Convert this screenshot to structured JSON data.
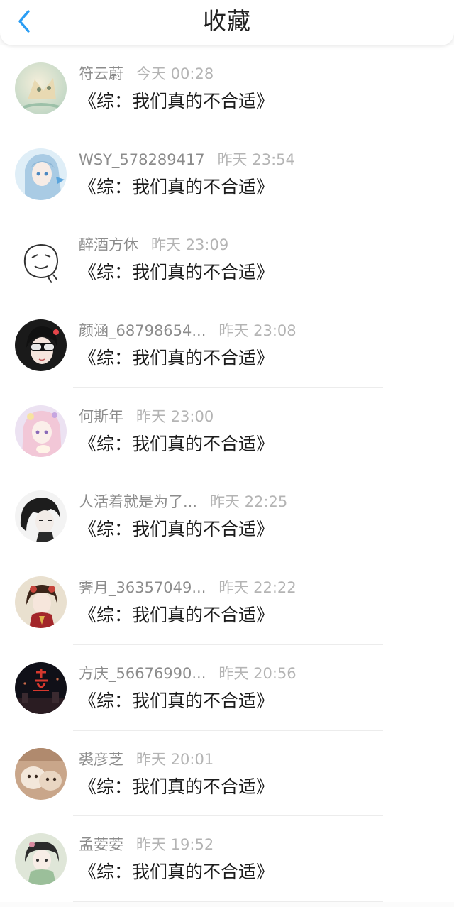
{
  "header": {
    "title": "收藏",
    "back_icon": "chevron-left-icon",
    "accent_color": "#2a9df4"
  },
  "items": [
    {
      "name": "符云蔚",
      "time": "今天 00:28",
      "content": "《综：我们真的不合适》",
      "avatar": "anime-cat-avatar"
    },
    {
      "name": "WSY_578289417",
      "time": "昨天 23:54",
      "content": "《综：我们真的不合适》",
      "avatar": "blue-hair-girl-avatar"
    },
    {
      "name": "醉酒方休",
      "time": "昨天 23:09",
      "content": "《综：我们真的不合适》",
      "avatar": "sketch-face-avatar"
    },
    {
      "name": "颜涵_68798654...",
      "time": "昨天 23:08",
      "content": "《综：我们真的不合适》",
      "avatar": "sunglasses-girl-avatar"
    },
    {
      "name": "何斯年",
      "time": "昨天 23:00",
      "content": "《综：我们真的不合适》",
      "avatar": "pink-anime-girl-avatar"
    },
    {
      "name": "人活着就是为了...",
      "time": "昨天 22:25",
      "content": "《综：我们真的不合适》",
      "avatar": "dark-hair-boy-avatar"
    },
    {
      "name": "霁月_36357049...",
      "time": "昨天 22:22",
      "content": "《综：我们真的不合适》",
      "avatar": "chinese-dress-girl-avatar"
    },
    {
      "name": "方庆_56676990...",
      "time": "昨天 20:56",
      "content": "《综：我们真的不合适》",
      "avatar": "night-city-avatar"
    },
    {
      "name": "裘彦芝",
      "time": "昨天 20:01",
      "content": "《综：我们真的不合适》",
      "avatar": "puppy-avatar"
    },
    {
      "name": "孟荌荌",
      "time": "昨天 19:52",
      "content": "《综：我们真的不合适》",
      "avatar": "guofeng-girl-avatar"
    }
  ]
}
